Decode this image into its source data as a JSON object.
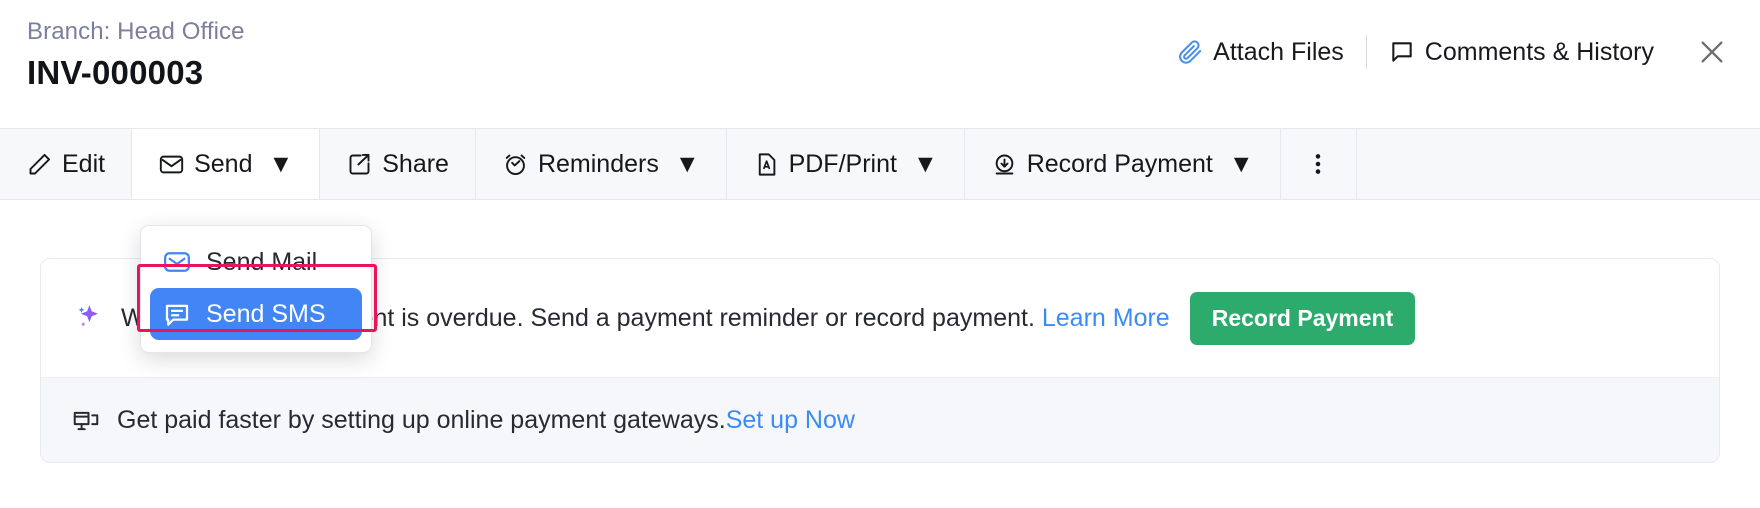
{
  "header": {
    "branch": "Branch: Head Office",
    "title": "INV-000003",
    "attach_label": "Attach Files",
    "comments_label": "Comments & History",
    "attach_icon": "paperclip-icon",
    "comments_icon": "comment-bubble-icon",
    "close_icon": "close-icon",
    "accent_blue": "#4a90e8"
  },
  "toolbar": {
    "items": [
      {
        "label": "Edit",
        "icon": "pencil-icon",
        "caret": "",
        "active": false
      },
      {
        "label": "Send",
        "icon": "envelope-icon",
        "caret": "▼",
        "active": true
      },
      {
        "label": "Share",
        "icon": "share-export-icon",
        "caret": "",
        "active": false
      },
      {
        "label": "Reminders",
        "icon": "alarm-clock-icon",
        "caret": "▼",
        "active": false
      },
      {
        "label": "PDF/Print",
        "icon": "pdf-file-icon",
        "caret": "▼",
        "active": false
      },
      {
        "label": "Record Payment",
        "icon": "download-circle-icon",
        "caret": "▼",
        "active": false
      }
    ],
    "kebab_icon": "more-vertical-icon",
    "background": "#f7f8fa"
  },
  "dropdown": {
    "items": [
      {
        "label": "Send Mail",
        "icon": "envelope-outline-icon",
        "selected": false
      },
      {
        "label": "Send SMS",
        "icon": "sms-bubble-icon",
        "selected": true
      }
    ],
    "selected_bg": "#4285f4",
    "annotation_color": "#e8145c"
  },
  "banner": {
    "icon": "sparkle-ai-icon",
    "text_before_link": "We noticed this payment is overdue. Send a payment reminder or record payment.",
    "link_label": "Learn More",
    "button_label": "Record Payment",
    "button_color": "#2cab6d",
    "link_color": "#3b8bf5"
  },
  "gateway": {
    "icon": "card-reader-icon",
    "text": "Get paid faster by setting up online payment gateways.",
    "link_label": "Set up Now"
  }
}
